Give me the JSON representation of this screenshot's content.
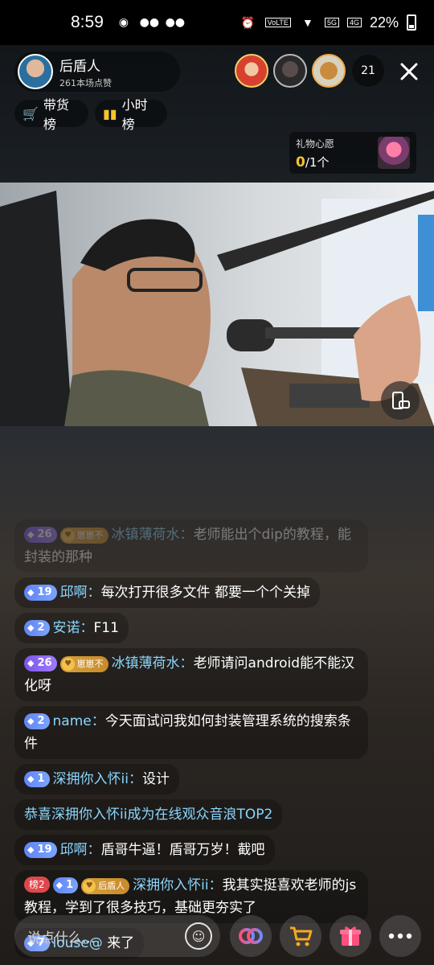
{
  "status_bar": {
    "time": "8:59",
    "volte": "VoLTE",
    "net1": "5G",
    "net2": "4G",
    "battery": "22%"
  },
  "host": {
    "name": "后盾人",
    "likes": "261本场点赞"
  },
  "viewer_count": "21",
  "rank_chips": {
    "cart": "带货榜",
    "hour": "小时榜"
  },
  "wish": {
    "title": "礼物心愿",
    "done": "0",
    "total": "/1个"
  },
  "chat": [
    {
      "level": "26",
      "level_style": "purple",
      "fan": "崽崽不",
      "user": "冰镇薄荷水：",
      "text": "老师能出个dip的教程，能封装的那种",
      "faded": true
    },
    {
      "level": "19",
      "level_style": "blue",
      "user": "邱啊：",
      "text": "每次打开很多文件 都要一个个关掉"
    },
    {
      "level": "2",
      "level_style": "blue",
      "user": "安诺：",
      "text": "F11"
    },
    {
      "level": "26",
      "level_style": "purple",
      "fan": "崽崽不",
      "user": "冰镇薄荷水：",
      "text": "老师请问android能不能汉化呀"
    },
    {
      "level": "2",
      "level_style": "blue",
      "user": "name：",
      "text": "今天面试问我如何封装管理系统的搜索条件"
    },
    {
      "level": "1",
      "level_style": "blue",
      "user": "深拥你入怀ii：",
      "text": "设计"
    },
    {
      "system": "恭喜深拥你入怀ii成为在线观众音浪TOP2"
    },
    {
      "level": "19",
      "level_style": "blue",
      "user": "邱啊：",
      "text": "盾哥牛逼！盾哥万岁！截吧"
    },
    {
      "rank": "榜2",
      "level": "1",
      "level_style": "blue",
      "fan": "后盾人",
      "user": "深拥你入怀ii：",
      "text": "我其实挺喜欢老师的js教程，学到了很多技巧，基础更夯实了"
    },
    {
      "level": "7",
      "level_style": "blue",
      "user": "louse@",
      "text": " 来了"
    }
  ],
  "input": {
    "placeholder": "说点什么..."
  },
  "colors": {
    "accent": "#f6c42b",
    "username": "#8ad7ff",
    "level_blue": "#6b8ff5",
    "level_purple": "#8a66ef"
  }
}
